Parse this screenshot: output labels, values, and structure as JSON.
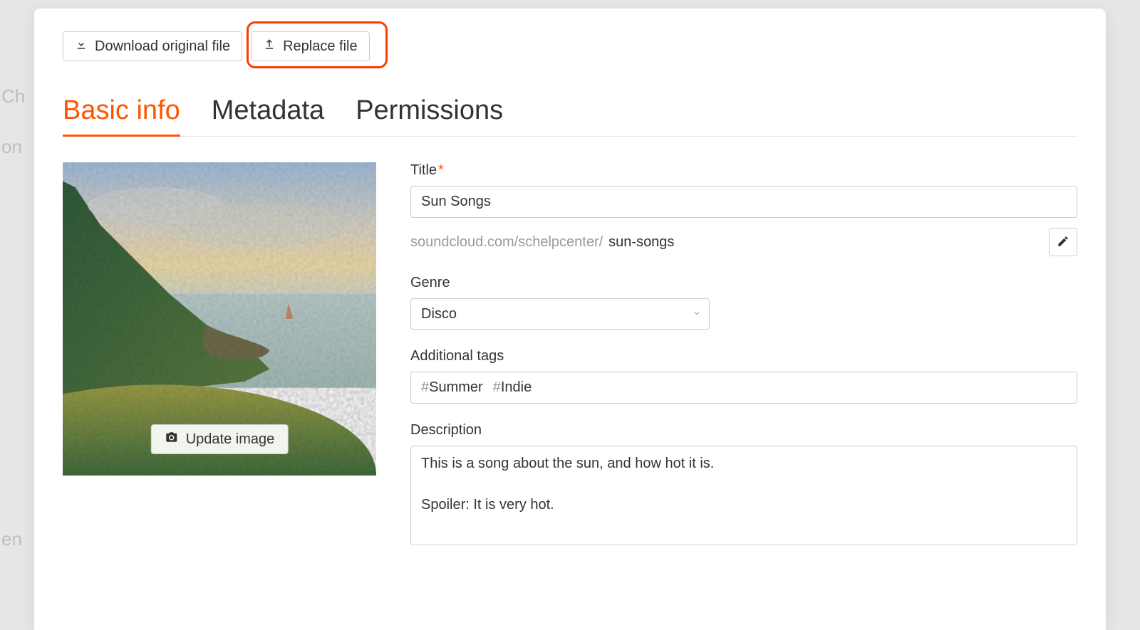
{
  "toolbar": {
    "download_label": "Download original file",
    "replace_label": "Replace file"
  },
  "tabs": {
    "basic": "Basic info",
    "metadata": "Metadata",
    "permissions": "Permissions",
    "active": "basic"
  },
  "cover": {
    "update_label": "Update image"
  },
  "form": {
    "title_label": "Title",
    "title_value": "Sun Songs",
    "permalink_base": "soundcloud.com/schelpcenter/",
    "permalink_slug": "sun-songs",
    "genre_label": "Genre",
    "genre_value": "Disco",
    "tags_label": "Additional tags",
    "tags": [
      "Summer",
      "Indie"
    ],
    "description_label": "Description",
    "description_value": "This is a song about the sun, and how hot it is.\n\nSpoiler: It is very hot."
  },
  "bg": {
    "a": "Ch",
    "b": "on",
    "c": "en"
  }
}
